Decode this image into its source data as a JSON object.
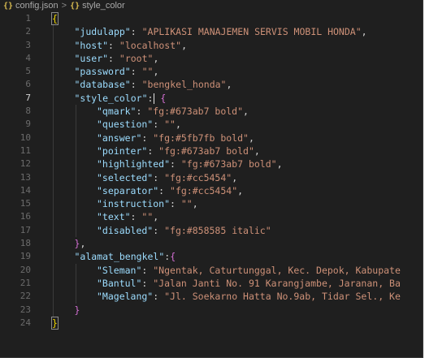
{
  "breadcrumb": {
    "file_icon": "{}",
    "file": "config.json",
    "separator": ">",
    "symbol_icon": "{}",
    "symbol": "style_color"
  },
  "active_line": 7,
  "lines": [
    {
      "n": "1",
      "indent": 0,
      "tokens": [
        {
          "c": "b",
          "t": "{"
        }
      ]
    },
    {
      "n": "2",
      "indent": 1,
      "tokens": [
        {
          "c": "k",
          "t": "\"judulapp\""
        },
        {
          "c": "p",
          "t": ": "
        },
        {
          "c": "s",
          "t": "\"APLIKASI MANAJEMEN SERVIS MOBIL HONDA\""
        },
        {
          "c": "p",
          "t": ","
        }
      ]
    },
    {
      "n": "3",
      "indent": 1,
      "tokens": [
        {
          "c": "k",
          "t": "\"host\""
        },
        {
          "c": "p",
          "t": ": "
        },
        {
          "c": "s",
          "t": "\"localhost\""
        },
        {
          "c": "p",
          "t": ","
        }
      ]
    },
    {
      "n": "4",
      "indent": 1,
      "tokens": [
        {
          "c": "k",
          "t": "\"user\""
        },
        {
          "c": "p",
          "t": ": "
        },
        {
          "c": "s",
          "t": "\"root\""
        },
        {
          "c": "p",
          "t": ","
        }
      ]
    },
    {
      "n": "5",
      "indent": 1,
      "tokens": [
        {
          "c": "k",
          "t": "\"password\""
        },
        {
          "c": "p",
          "t": ": "
        },
        {
          "c": "s",
          "t": "\"\""
        },
        {
          "c": "p",
          "t": ","
        }
      ]
    },
    {
      "n": "6",
      "indent": 1,
      "tokens": [
        {
          "c": "k",
          "t": "\"database\""
        },
        {
          "c": "p",
          "t": ": "
        },
        {
          "c": "s",
          "t": "\"bengkel_honda\""
        },
        {
          "c": "p",
          "t": ","
        }
      ]
    },
    {
      "n": "7",
      "indent": 1,
      "tokens": [
        {
          "c": "k",
          "t": "\"style_color\""
        },
        {
          "c": "p",
          "t": ":"
        },
        {
          "c": "cursor",
          "t": ""
        },
        {
          "c": "p",
          "t": " "
        },
        {
          "c": "b2",
          "t": "{"
        }
      ]
    },
    {
      "n": "8",
      "indent": 2,
      "tokens": [
        {
          "c": "k",
          "t": "\"qmark\""
        },
        {
          "c": "p",
          "t": ": "
        },
        {
          "c": "s",
          "t": "\"fg:#673ab7 bold\""
        },
        {
          "c": "p",
          "t": ","
        }
      ]
    },
    {
      "n": "9",
      "indent": 2,
      "tokens": [
        {
          "c": "k",
          "t": "\"question\""
        },
        {
          "c": "p",
          "t": ": "
        },
        {
          "c": "s",
          "t": "\"\""
        },
        {
          "c": "p",
          "t": ","
        }
      ]
    },
    {
      "n": "10",
      "indent": 2,
      "tokens": [
        {
          "c": "k",
          "t": "\"answer\""
        },
        {
          "c": "p",
          "t": ": "
        },
        {
          "c": "s",
          "t": "\"fg:#5fb7fb bold\""
        },
        {
          "c": "p",
          "t": ","
        }
      ]
    },
    {
      "n": "11",
      "indent": 2,
      "tokens": [
        {
          "c": "k",
          "t": "\"pointer\""
        },
        {
          "c": "p",
          "t": ": "
        },
        {
          "c": "s",
          "t": "\"fg:#673ab7 bold\""
        },
        {
          "c": "p",
          "t": ","
        }
      ]
    },
    {
      "n": "12",
      "indent": 2,
      "tokens": [
        {
          "c": "k",
          "t": "\"highlighted\""
        },
        {
          "c": "p",
          "t": ": "
        },
        {
          "c": "s",
          "t": "\"fg:#673ab7 bold\""
        },
        {
          "c": "p",
          "t": ","
        }
      ]
    },
    {
      "n": "13",
      "indent": 2,
      "tokens": [
        {
          "c": "k",
          "t": "\"selected\""
        },
        {
          "c": "p",
          "t": ": "
        },
        {
          "c": "s",
          "t": "\"fg:#cc5454\""
        },
        {
          "c": "p",
          "t": ","
        }
      ]
    },
    {
      "n": "14",
      "indent": 2,
      "tokens": [
        {
          "c": "k",
          "t": "\"separator\""
        },
        {
          "c": "p",
          "t": ": "
        },
        {
          "c": "s",
          "t": "\"fg:#cc5454\""
        },
        {
          "c": "p",
          "t": ","
        }
      ]
    },
    {
      "n": "15",
      "indent": 2,
      "tokens": [
        {
          "c": "k",
          "t": "\"instruction\""
        },
        {
          "c": "p",
          "t": ": "
        },
        {
          "c": "s",
          "t": "\"\""
        },
        {
          "c": "p",
          "t": ","
        }
      ]
    },
    {
      "n": "16",
      "indent": 2,
      "tokens": [
        {
          "c": "k",
          "t": "\"text\""
        },
        {
          "c": "p",
          "t": ": "
        },
        {
          "c": "s",
          "t": "\"\""
        },
        {
          "c": "p",
          "t": ","
        }
      ]
    },
    {
      "n": "17",
      "indent": 2,
      "tokens": [
        {
          "c": "k",
          "t": "\"disabled\""
        },
        {
          "c": "p",
          "t": ": "
        },
        {
          "c": "s",
          "t": "\"fg:#858585 italic\""
        }
      ]
    },
    {
      "n": "18",
      "indent": 1,
      "tokens": [
        {
          "c": "b2",
          "t": "}"
        },
        {
          "c": "p",
          "t": ","
        }
      ]
    },
    {
      "n": "19",
      "indent": 1,
      "tokens": [
        {
          "c": "k",
          "t": "\"alamat_bengkel\""
        },
        {
          "c": "p",
          "t": ":"
        },
        {
          "c": "b2",
          "t": "{"
        }
      ]
    },
    {
      "n": "20",
      "indent": 2,
      "tokens": [
        {
          "c": "k",
          "t": "\"Sleman\""
        },
        {
          "c": "p",
          "t": ": "
        },
        {
          "c": "s",
          "t": "\"Ngentak, Caturtunggal, Kec. Depok, Kabupate"
        }
      ]
    },
    {
      "n": "21",
      "indent": 2,
      "tokens": [
        {
          "c": "k",
          "t": "\"Bantul\""
        },
        {
          "c": "p",
          "t": ": "
        },
        {
          "c": "s",
          "t": "\"Jalan Janti No. 91 Karangjambe, Jaranan, Ba"
        }
      ]
    },
    {
      "n": "22",
      "indent": 2,
      "tokens": [
        {
          "c": "k",
          "t": "\"Magelang\""
        },
        {
          "c": "p",
          "t": ": "
        },
        {
          "c": "s",
          "t": "\"Jl. Soekarno Hatta No.9ab, Tidar Sel., Ke"
        }
      ]
    },
    {
      "n": "23",
      "indent": 1,
      "tokens": [
        {
          "c": "b2",
          "t": "}"
        }
      ]
    },
    {
      "n": "24",
      "indent": 0,
      "tokens": [
        {
          "c": "b",
          "t": "}"
        }
      ]
    }
  ]
}
